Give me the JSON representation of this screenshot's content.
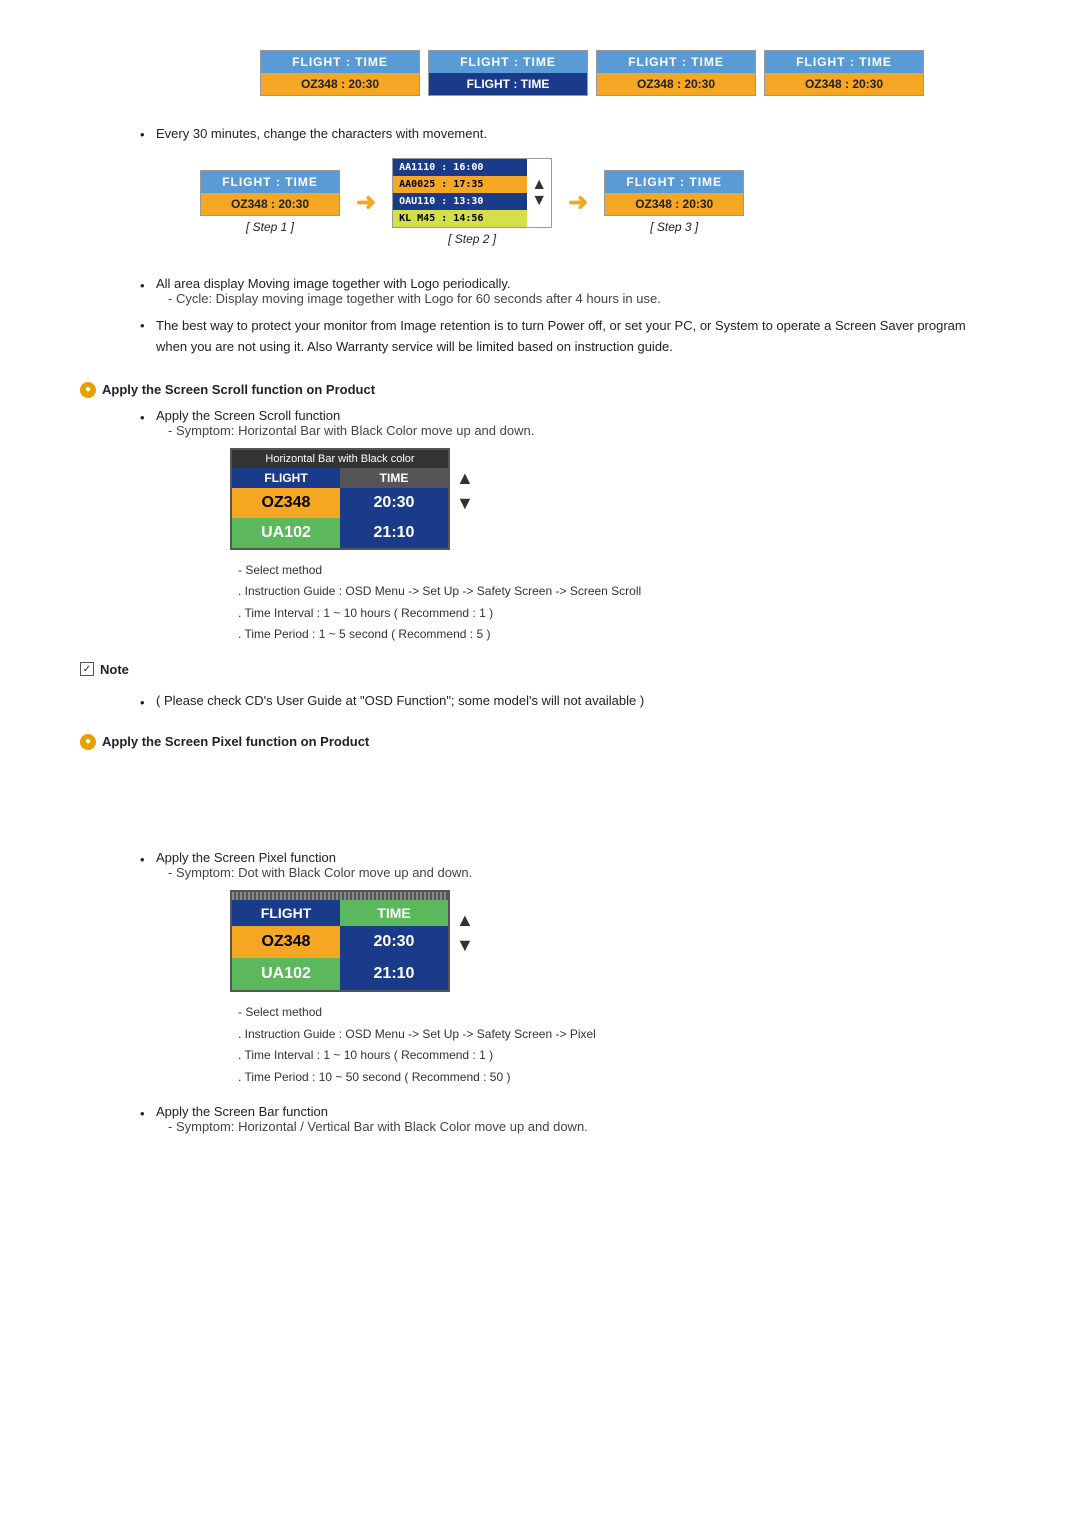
{
  "header_panels": [
    {
      "top": "FLIGHT  :  TIME",
      "bottom": "OZ348   :  20:30",
      "bottom_class": "orange"
    },
    {
      "top": "FLIGHT  :  TIME",
      "bottom": "FLIGHT  :  TIME",
      "bottom_class": "blue"
    },
    {
      "top": "FLIGHT  :  TIME",
      "bottom": "OZ348   :  20:30",
      "bottom_class": "orange"
    },
    {
      "top": "FLIGHT  :  TIME",
      "bottom": "OZ348   :  20:30",
      "bottom_class": "orange"
    }
  ],
  "step_bullet": "Every 30 minutes, change the characters with movement.",
  "step1": {
    "top": "FLIGHT  :  TIME",
    "bottom": "OZ348   :  20:30",
    "label": "[ Step 1 ]"
  },
  "step2": {
    "label": "[ Step 2 ]"
  },
  "step3": {
    "top": "FLIGHT  :  TIME",
    "bottom": "OZ348   :  20:30",
    "label": "[ Step 3 ]"
  },
  "info_bullets": [
    {
      "text": "All area display Moving image together with Logo periodically.",
      "sub": "- Cycle: Display moving image together with Logo for 60 seconds after 4 hours in use."
    },
    {
      "text": "The best way to protect your monitor from Image retention is to turn Power off, or set your PC, or System to operate a Screen Saver program when you are not using it. Also Warranty service will be limited based on instruction guide."
    }
  ],
  "section_scroll": {
    "title": "Apply the Screen Scroll function on Product",
    "bullet1": "Apply the Screen Scroll function",
    "symptom": "- Symptom: Horizontal Bar with Black Color move up and down.",
    "table_header": "Horizontal Bar with Black color",
    "col1_header": "FLIGHT",
    "col2_header": "TIME",
    "row1_col1": "OZ348",
    "row1_col2": "20:30",
    "row2_col1": "UA102",
    "row2_col2": "21:10",
    "select_method": "- Select method",
    "guide_line1": ". Instruction Guide : OSD Menu -> Set Up -> Safety Screen -> Screen Scroll",
    "guide_line2": ". Time Interval : 1 ~ 10 hours ( Recommend : 1 )",
    "guide_line3": ". Time Period : 1 ~ 5 second ( Recommend : 5 )"
  },
  "note": {
    "label": "Note",
    "text": "( Please check CD's User Guide at \"OSD Function\"; some model's will not available )"
  },
  "section_pixel": {
    "title": "Apply the Screen Pixel function on Product",
    "bullet1": "Apply the Screen Pixel function",
    "symptom": "- Symptom: Dot with Black Color move up and down.",
    "col1_header": "FLIGHT",
    "col2_header": "TIME",
    "row1_col1": "OZ348",
    "row1_col2": "20:30",
    "row2_col1": "UA102",
    "row2_col2": "21:10",
    "select_method": "- Select method",
    "guide_line1": ". Instruction Guide : OSD Menu -> Set Up -> Safety Screen -> Pixel",
    "guide_line2": ". Time Interval : 1 ~ 10 hours ( Recommend : 1 )",
    "guide_line3": ". Time Period : 10 ~ 50 second ( Recommend : 50 )"
  },
  "section_bar": {
    "bullet1": "Apply the Screen Bar function",
    "symptom": "- Symptom: Horizontal / Vertical Bar with Black Color move up and down."
  }
}
